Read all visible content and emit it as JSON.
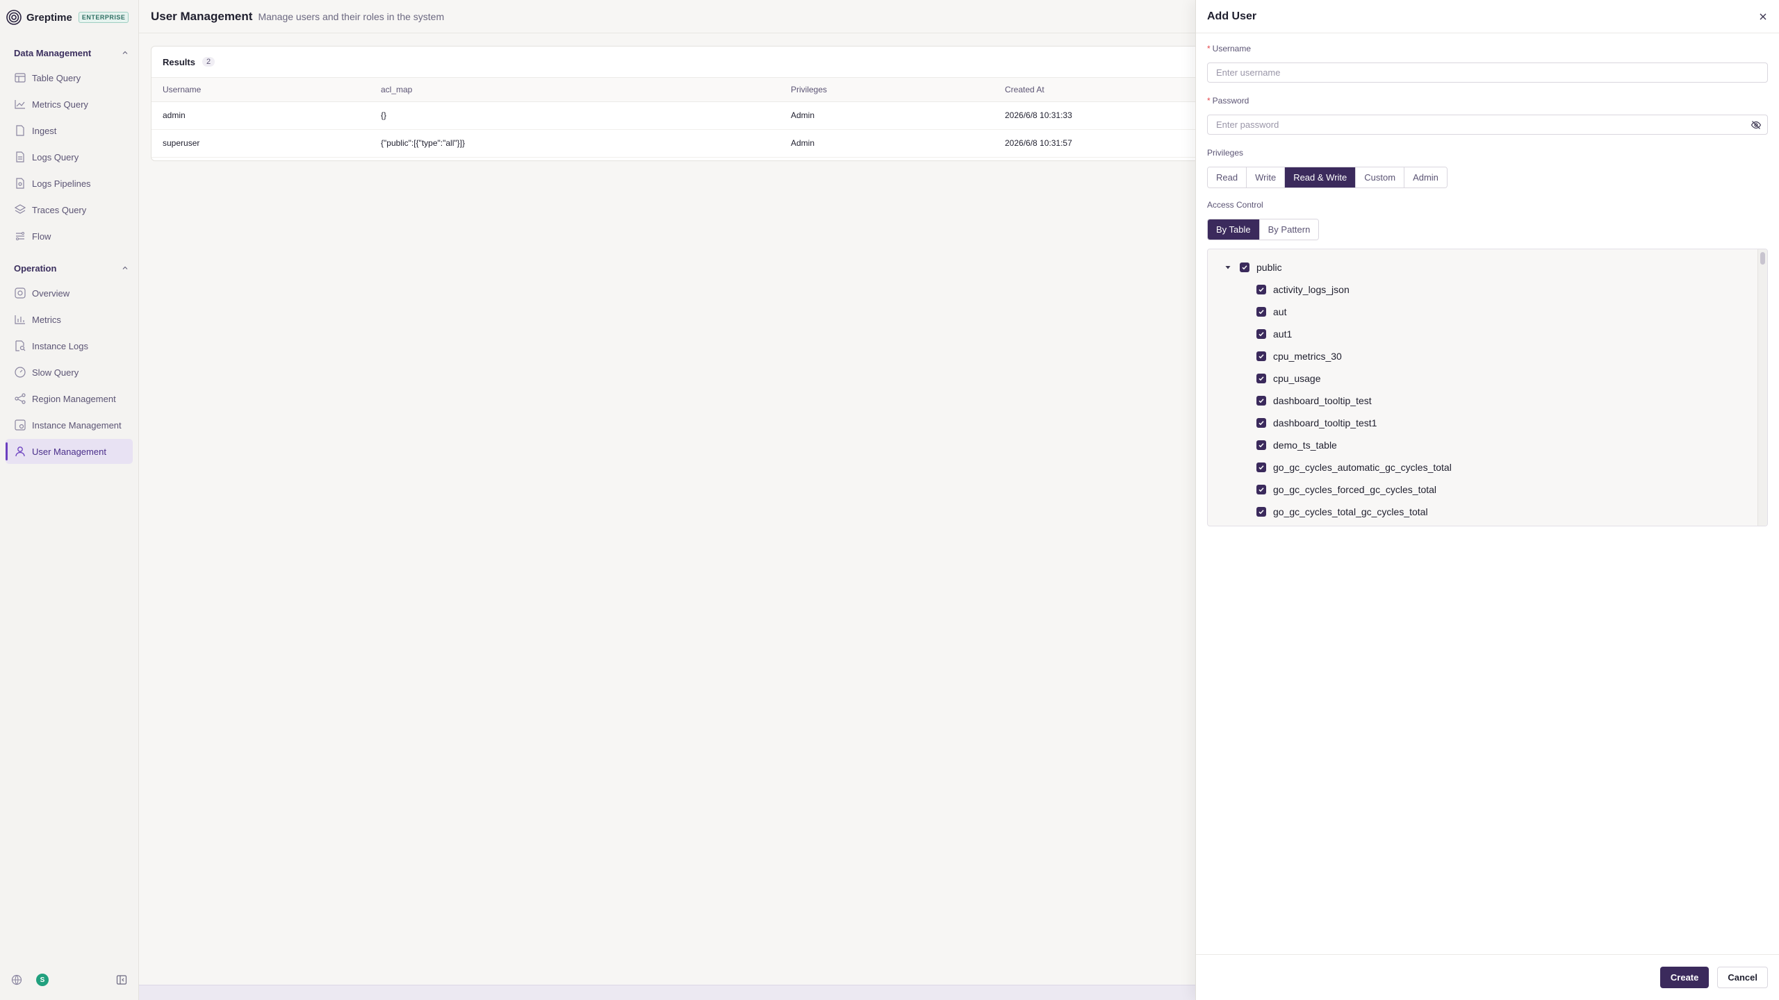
{
  "brand": {
    "name": "Greptime",
    "badge": "ENTERPRISE"
  },
  "sidebar": {
    "sections": [
      {
        "title": "Data Management",
        "items": [
          {
            "label": "Table Query",
            "icon": "table-icon"
          },
          {
            "label": "Metrics Query",
            "icon": "chart-line-icon"
          },
          {
            "label": "Ingest",
            "icon": "file-icon"
          },
          {
            "label": "Logs Query",
            "icon": "file-text-icon"
          },
          {
            "label": "Logs Pipelines",
            "icon": "pipeline-icon"
          },
          {
            "label": "Traces Query",
            "icon": "layers-icon"
          },
          {
            "label": "Flow",
            "icon": "flow-icon"
          }
        ]
      },
      {
        "title": "Operation",
        "items": [
          {
            "label": "Overview",
            "icon": "overview-icon"
          },
          {
            "label": "Metrics",
            "icon": "bar-chart-icon"
          },
          {
            "label": "Instance Logs",
            "icon": "search-doc-icon"
          },
          {
            "label": "Slow Query",
            "icon": "gauge-icon"
          },
          {
            "label": "Region Management",
            "icon": "share-icon"
          },
          {
            "label": "Instance Management",
            "icon": "server-icon"
          },
          {
            "label": "User Management",
            "icon": "user-icon",
            "active": true
          }
        ]
      }
    ],
    "footer": {
      "avatar_initial": "S"
    }
  },
  "header": {
    "title": "User Management",
    "subtitle": "Manage users and their roles in the system"
  },
  "results": {
    "label": "Results",
    "count": "2",
    "columns": [
      "Username",
      "acl_map",
      "Privileges",
      "Created At"
    ],
    "rows": [
      [
        "admin",
        "{}",
        "Admin",
        "2026/6/8 10:31:33"
      ],
      [
        "superuser",
        "{\"public\":[{\"type\":\"all\"}]}",
        "Admin",
        "2026/6/8 10:31:57"
      ]
    ]
  },
  "drawer": {
    "title": "Add User",
    "username_label": "Username",
    "username_placeholder": "Enter username",
    "password_label": "Password",
    "password_placeholder": "Enter password",
    "privileges_label": "Privileges",
    "privileges": [
      "Read",
      "Write",
      "Read & Write",
      "Custom",
      "Admin"
    ],
    "privileges_selected": "Read & Write",
    "access_label": "Access Control",
    "access_modes": [
      "By Table",
      "By Pattern"
    ],
    "access_selected": "By Table",
    "tree_root": "public",
    "tables": [
      "activity_logs_json",
      "aut",
      "aut1",
      "cpu_metrics_30",
      "cpu_usage",
      "dashboard_tooltip_test",
      "dashboard_tooltip_test1",
      "demo_ts_table",
      "go_gc_cycles_automatic_gc_cycles_total",
      "go_gc_cycles_forced_gc_cycles_total",
      "go_gc_cycles_total_gc_cycles_total"
    ],
    "create_label": "Create",
    "cancel_label": "Cancel"
  },
  "colors": {
    "accent": "#3b2a5c",
    "active_nav": "#e8e2f3",
    "brand_green": "#21a07e"
  }
}
